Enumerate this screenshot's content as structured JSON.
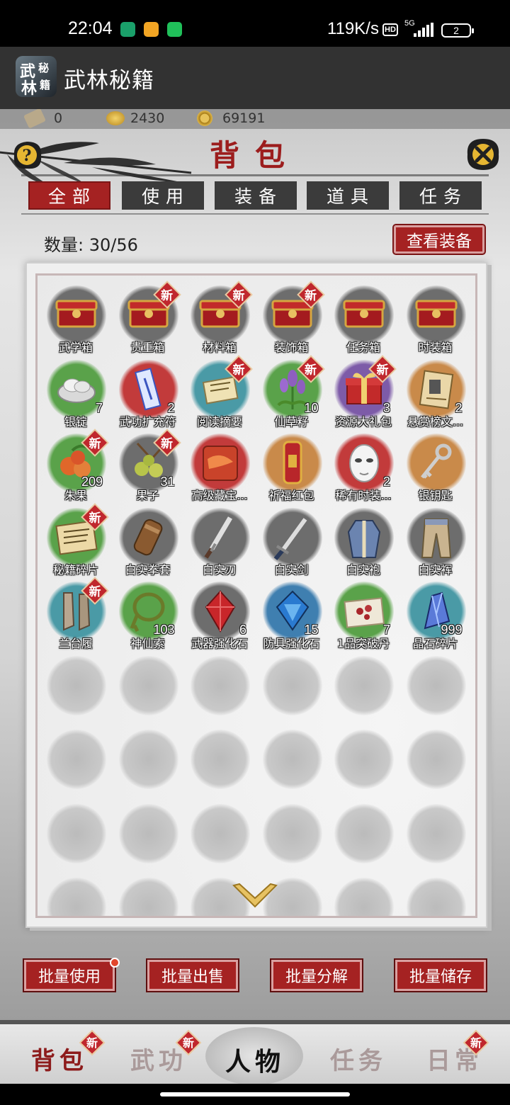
{
  "status_bar": {
    "time": "22:04",
    "network_speed": "119K/s",
    "hd_label": "HD",
    "network_type": "5G",
    "battery": "2"
  },
  "app_bar": {
    "title": "武林秘籍",
    "icon_text": [
      "武",
      "林",
      "秘",
      "籍"
    ]
  },
  "resources": {
    "scroll": "0",
    "gold": "2430",
    "coin": "69191"
  },
  "panel_title": "背包",
  "tabs": [
    "全部",
    "使用",
    "装备",
    "道具",
    "任务"
  ],
  "active_tab": "全部",
  "count_text": "数量: 30/56",
  "view_equipment_label": "查看装备",
  "new_badge": "新",
  "items": [
    {
      "name": "武学箱",
      "qty": "",
      "new": false,
      "icon": "red-chest",
      "bg": "#6d6d6d"
    },
    {
      "name": "贵重箱",
      "qty": "",
      "new": true,
      "icon": "red-chest",
      "bg": "#6d6d6d"
    },
    {
      "name": "材料箱",
      "qty": "",
      "new": true,
      "icon": "red-chest",
      "bg": "#6d6d6d"
    },
    {
      "name": "装饰箱",
      "qty": "",
      "new": true,
      "icon": "red-chest",
      "bg": "#6d6d6d"
    },
    {
      "name": "任务箱",
      "qty": "",
      "new": false,
      "icon": "red-chest",
      "bg": "#6d6d6d"
    },
    {
      "name": "时装箱",
      "qty": "",
      "new": false,
      "icon": "red-chest",
      "bg": "#6d6d6d"
    },
    {
      "name": "银锭",
      "qty": "7",
      "new": false,
      "icon": "silver-ingot",
      "bg": "#5aa24a"
    },
    {
      "name": "武功扩充符",
      "qty": "2",
      "new": false,
      "icon": "talisman",
      "bg": "#c23b3b"
    },
    {
      "name": "阅读摘要",
      "qty": "",
      "new": true,
      "icon": "reading-note",
      "bg": "#4a9aa6"
    },
    {
      "name": "仙草籽",
      "qty": "10",
      "new": true,
      "icon": "lavender-herb",
      "bg": "#5aa24a"
    },
    {
      "name": "资源大礼包",
      "qty": "3",
      "new": true,
      "icon": "gift-box",
      "bg": "#7d5ba8"
    },
    {
      "name": "悬赏榜文...",
      "qty": "2",
      "new": false,
      "icon": "bounty-scroll",
      "bg": "#c98a4a"
    },
    {
      "name": "朱果",
      "qty": "209",
      "new": true,
      "icon": "red-fruit",
      "bg": "#5aa24a"
    },
    {
      "name": "果子",
      "qty": "31",
      "new": true,
      "icon": "green-fruit",
      "bg": "#6d6d6d"
    },
    {
      "name": "高级藏宝...",
      "qty": "",
      "new": false,
      "icon": "treasure-map",
      "bg": "#c23b3b"
    },
    {
      "name": "祈福红包",
      "qty": "",
      "new": false,
      "icon": "red-envelope",
      "bg": "#c98a4a"
    },
    {
      "name": "稀有时装...",
      "qty": "2",
      "new": false,
      "icon": "white-mask",
      "bg": "#c23b3b"
    },
    {
      "name": "银钥匙",
      "qty": "",
      "new": false,
      "icon": "silver-key",
      "bg": "#c98a4a"
    },
    {
      "name": "秘籍碎片",
      "qty": "",
      "new": true,
      "icon": "scroll-fragment",
      "bg": "#5aa24a"
    },
    {
      "name": "白实拳套",
      "qty": "",
      "new": false,
      "icon": "fist-guard",
      "bg": "#6d6d6d"
    },
    {
      "name": "白实刃",
      "qty": "",
      "new": false,
      "icon": "blade",
      "bg": "#6d6d6d"
    },
    {
      "name": "白实剑",
      "qty": "",
      "new": false,
      "icon": "sword",
      "bg": "#6d6d6d"
    },
    {
      "name": "白实袍",
      "qty": "",
      "new": false,
      "icon": "robe",
      "bg": "#6d6d6d"
    },
    {
      "name": "白实裈",
      "qty": "",
      "new": false,
      "icon": "trousers",
      "bg": "#6d6d6d"
    },
    {
      "name": "兰台履",
      "qty": "",
      "new": true,
      "icon": "boots",
      "bg": "#4a9aa6"
    },
    {
      "name": "神仙索",
      "qty": "103",
      "new": false,
      "icon": "rope",
      "bg": "#5aa24a"
    },
    {
      "name": "武器强化石",
      "qty": "6",
      "new": false,
      "icon": "red-gem",
      "bg": "#6d6d6d"
    },
    {
      "name": "防具强化石",
      "qty": "15",
      "new": false,
      "icon": "blue-gem",
      "bg": "#3f7fb0"
    },
    {
      "name": "1品突破丹",
      "qty": "7",
      "new": false,
      "icon": "pill",
      "bg": "#5aa24a"
    },
    {
      "name": "晶石碎片",
      "qty": "999",
      "new": false,
      "icon": "crystal",
      "bg": "#4a9aa6"
    }
  ],
  "empty_slot_count": 24,
  "bottom_buttons": [
    "批量使用",
    "批量出售",
    "批量分解",
    "批量储存"
  ],
  "nav": [
    "背包",
    "武功",
    "人物",
    "任务",
    "日常"
  ],
  "nav_active": "背包"
}
